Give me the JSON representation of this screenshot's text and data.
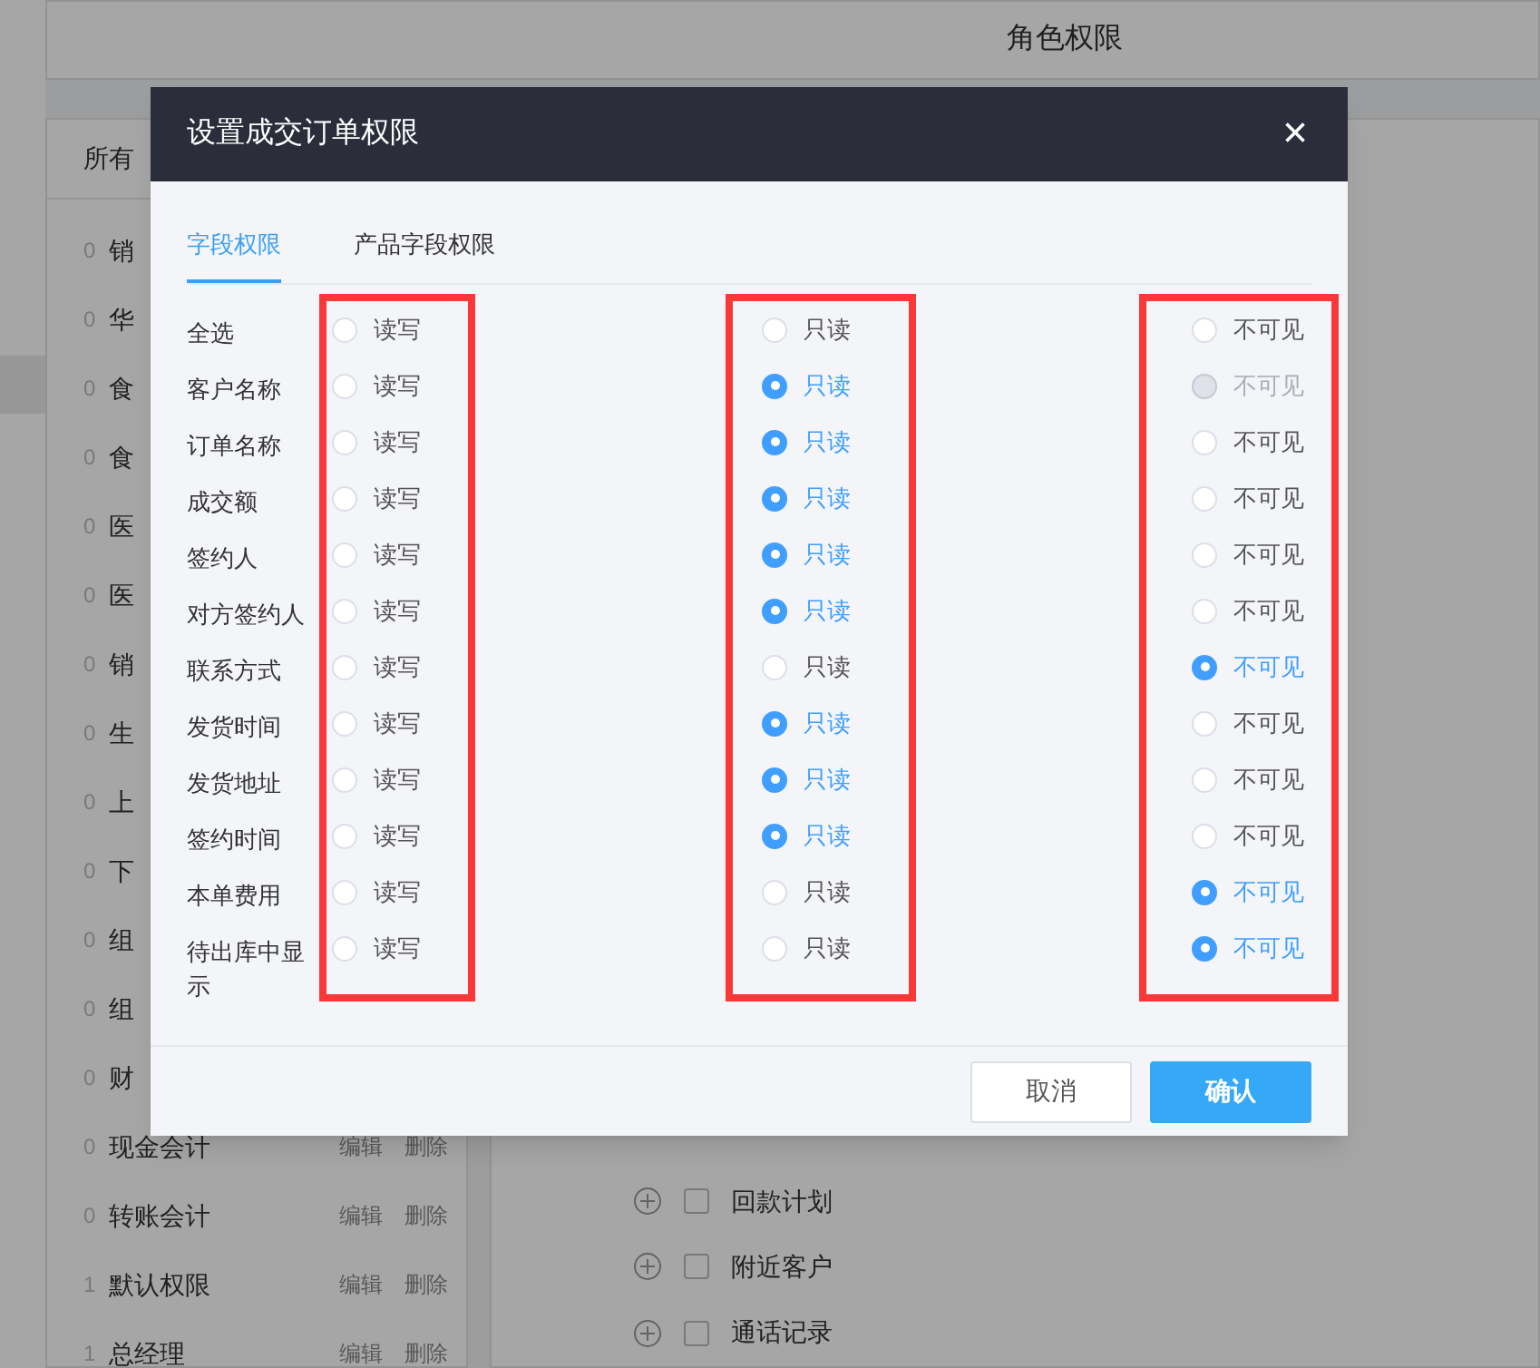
{
  "page": {
    "title": "角色权限"
  },
  "roles_panel": {
    "header": "所有",
    "roles": [
      {
        "count": "0",
        "name": "销"
      },
      {
        "count": "0",
        "name": "华"
      },
      {
        "count": "0",
        "name": "食"
      },
      {
        "count": "0",
        "name": "食"
      },
      {
        "count": "0",
        "name": "医"
      },
      {
        "count": "0",
        "name": "医"
      },
      {
        "count": "0",
        "name": "销"
      },
      {
        "count": "0",
        "name": "生"
      },
      {
        "count": "0",
        "name": "上"
      },
      {
        "count": "0",
        "name": "下"
      },
      {
        "count": "0",
        "name": "组"
      },
      {
        "count": "0",
        "name": "组"
      },
      {
        "count": "0",
        "name": "财"
      },
      {
        "count": "0",
        "name": "现金会计",
        "actions": [
          "编辑",
          "删除"
        ]
      },
      {
        "count": "0",
        "name": "转账会计",
        "actions": [
          "编辑",
          "删除"
        ]
      },
      {
        "count": "1",
        "name": "默认权限",
        "actions": [
          "编辑",
          "删除"
        ]
      },
      {
        "count": "1",
        "name": "总经理",
        "actions": [
          "编辑",
          "删除"
        ]
      }
    ]
  },
  "modules": [
    {
      "name": "回款计划",
      "checked": false
    },
    {
      "name": "附近客户",
      "checked": false
    },
    {
      "name": "通话记录",
      "checked": false
    }
  ],
  "dialog": {
    "title": "设置成交订单权限",
    "close": "×",
    "tabs": [
      {
        "label": "字段权限",
        "selected": true
      },
      {
        "label": "产品字段权限",
        "selected": false
      }
    ],
    "option_columns": [
      {
        "highlighted": true
      },
      {
        "highlighted": true
      },
      {
        "highlighted": true
      }
    ],
    "rows": [
      {
        "label": "全选",
        "options": [
          {
            "text": "读写",
            "selected": false,
            "disabled": false
          },
          {
            "text": "只读",
            "selected": false,
            "disabled": false
          },
          {
            "text": "不可见",
            "selected": false,
            "disabled": false
          }
        ]
      },
      {
        "label": "客户名称",
        "options": [
          {
            "text": "读写",
            "selected": false,
            "disabled": false
          },
          {
            "text": "只读",
            "selected": true,
            "disabled": false
          },
          {
            "text": "不可见",
            "selected": false,
            "disabled": true
          }
        ]
      },
      {
        "label": "订单名称",
        "options": [
          {
            "text": "读写",
            "selected": false,
            "disabled": false
          },
          {
            "text": "只读",
            "selected": true,
            "disabled": false
          },
          {
            "text": "不可见",
            "selected": false,
            "disabled": false
          }
        ]
      },
      {
        "label": "成交额",
        "options": [
          {
            "text": "读写",
            "selected": false,
            "disabled": false
          },
          {
            "text": "只读",
            "selected": true,
            "disabled": false
          },
          {
            "text": "不可见",
            "selected": false,
            "disabled": false
          }
        ]
      },
      {
        "label": "签约人",
        "options": [
          {
            "text": "读写",
            "selected": false,
            "disabled": false
          },
          {
            "text": "只读",
            "selected": true,
            "disabled": false
          },
          {
            "text": "不可见",
            "selected": false,
            "disabled": false
          }
        ]
      },
      {
        "label": "对方签约人",
        "options": [
          {
            "text": "读写",
            "selected": false,
            "disabled": false
          },
          {
            "text": "只读",
            "selected": true,
            "disabled": false
          },
          {
            "text": "不可见",
            "selected": false,
            "disabled": false
          }
        ]
      },
      {
        "label": "联系方式",
        "options": [
          {
            "text": "读写",
            "selected": false,
            "disabled": false
          },
          {
            "text": "只读",
            "selected": false,
            "disabled": false
          },
          {
            "text": "不可见",
            "selected": true,
            "disabled": false
          }
        ]
      },
      {
        "label": "发货时间",
        "options": [
          {
            "text": "读写",
            "selected": false,
            "disabled": false
          },
          {
            "text": "只读",
            "selected": true,
            "disabled": false
          },
          {
            "text": "不可见",
            "selected": false,
            "disabled": false
          }
        ]
      },
      {
        "label": "发货地址",
        "options": [
          {
            "text": "读写",
            "selected": false,
            "disabled": false
          },
          {
            "text": "只读",
            "selected": true,
            "disabled": false
          },
          {
            "text": "不可见",
            "selected": false,
            "disabled": false
          }
        ]
      },
      {
        "label": "签约时间",
        "options": [
          {
            "text": "读写",
            "selected": false,
            "disabled": false
          },
          {
            "text": "只读",
            "selected": true,
            "disabled": false
          },
          {
            "text": "不可见",
            "selected": false,
            "disabled": false
          }
        ]
      },
      {
        "label": "本单费用",
        "options": [
          {
            "text": "读写",
            "selected": false,
            "disabled": false
          },
          {
            "text": "只读",
            "selected": false,
            "disabled": false
          },
          {
            "text": "不可见",
            "selected": true,
            "disabled": false
          }
        ]
      },
      {
        "label": "待出库中显示",
        "options": [
          {
            "text": "读写",
            "selected": false,
            "disabled": false
          },
          {
            "text": "只读",
            "selected": false,
            "disabled": false
          },
          {
            "text": "不可见",
            "selected": true,
            "disabled": false
          }
        ]
      }
    ],
    "buttons": [
      {
        "label": "取消",
        "kind": "secondary"
      },
      {
        "label": "确认",
        "kind": "primary"
      }
    ]
  }
}
